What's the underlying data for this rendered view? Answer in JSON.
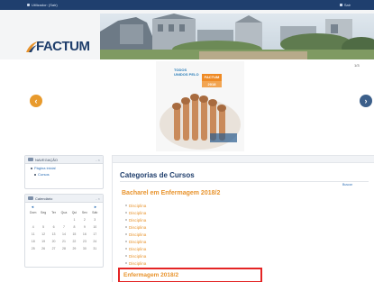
{
  "topbar": {
    "user_text": "Utilizador: (Sair)",
    "right_text": "Sair"
  },
  "header": {
    "logo_text": "FACTUM"
  },
  "carousel": {
    "counter": "1/3",
    "prev_icon": "chevron-left-icon",
    "next_icon": "chevron-right-icon",
    "banner_title_line1": "TODOS",
    "banner_title_line2": "UNIDOS PELO",
    "banner_tag_line1": "FACTUM",
    "banner_tag_line2": "2018"
  },
  "sidebar": {
    "navigation": {
      "title": "NAVEGAÇÃO",
      "controls": "- ×",
      "items": [
        "Página inicial",
        "Cursos"
      ]
    },
    "calendar": {
      "title": "Calendário",
      "controls": "- ×",
      "prev": "◄",
      "month": "",
      "next": "►",
      "weekdays": [
        "Dom",
        "Seg",
        "Ter",
        "Qua",
        "Qui",
        "Sex",
        "Sáb"
      ],
      "days": [
        "",
        "",
        "",
        "",
        "1",
        "2",
        "3",
        "4",
        "5",
        "6",
        "7",
        "8",
        "9",
        "10",
        "11",
        "12",
        "13",
        "14",
        "15",
        "16",
        "17",
        "18",
        "19",
        "20",
        "21",
        "22",
        "23",
        "24",
        "25",
        "26",
        "27",
        "28",
        "29",
        "30",
        "31"
      ]
    }
  },
  "main": {
    "title": "Categorias de Cursos",
    "search_link": "Buscar",
    "category1": "Bacharel em Enfermagem 2018/2",
    "courses": [
      {
        "name": "Disciplina",
        "count": ""
      },
      {
        "name": "Disciplina",
        "count": ""
      },
      {
        "name": "Disciplina",
        "count": ""
      },
      {
        "name": "Disciplina",
        "count": ""
      },
      {
        "name": "Disciplina",
        "count": ""
      },
      {
        "name": "Disciplina",
        "count": ""
      },
      {
        "name": "Disciplina",
        "count": ""
      },
      {
        "name": "Disciplina",
        "count": ""
      },
      {
        "name": "Disciplina",
        "count": ""
      }
    ],
    "category2": "Enfermagem 2018/2"
  },
  "colors": {
    "topbar": "#1f3f6e",
    "accent_orange": "#e8932c",
    "link_blue": "#2a6db5",
    "highlight_red": "#e42424"
  }
}
